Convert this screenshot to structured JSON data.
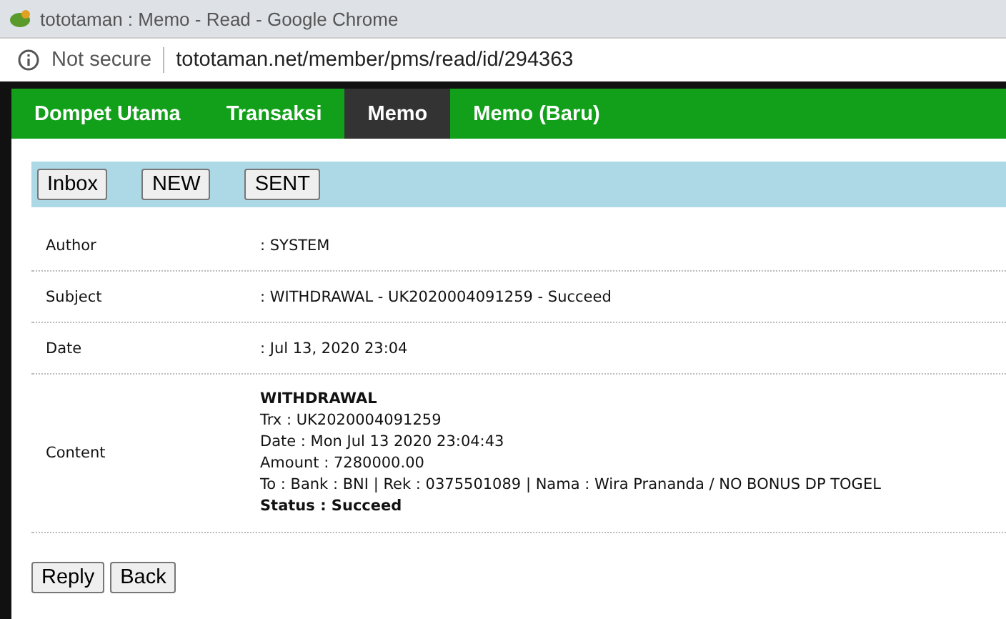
{
  "window": {
    "title": "tototaman : Memo - Read - Google Chrome"
  },
  "address_bar": {
    "security": "Not secure",
    "url": "tototaman.net/member/pms/read/id/294363"
  },
  "nav": [
    {
      "label": "Dompet Utama",
      "selected": false
    },
    {
      "label": "Transaksi",
      "selected": false
    },
    {
      "label": "Memo",
      "selected": true
    },
    {
      "label": "Memo (Baru)",
      "selected": false
    }
  ],
  "toolbar": [
    "Inbox",
    "NEW",
    "SENT"
  ],
  "fields": [
    {
      "label": "Author",
      "value": ": SYSTEM"
    },
    {
      "label": "Subject",
      "value": ": WITHDRAWAL - UK2020004091259 - Succeed"
    },
    {
      "label": "Date",
      "value": ": Jul 13, 2020 23:04"
    }
  ],
  "content": {
    "label": "Content",
    "lines": [
      {
        "text": "WITHDRAWAL",
        "bold": true
      },
      {
        "text": "Trx : UK2020004091259",
        "bold": false
      },
      {
        "text": "Date : Mon Jul 13 2020 23:04:43",
        "bold": false
      },
      {
        "text": "Amount : 7280000.00",
        "bold": false
      },
      {
        "text": "To : Bank : BNI | Rek : 0375501089 | Nama : Wira Prananda / NO BONUS DP TOGEL",
        "bold": false
      },
      {
        "text": "Status : Succeed",
        "bold": true
      }
    ]
  },
  "actions": [
    "Reply",
    "Back"
  ]
}
